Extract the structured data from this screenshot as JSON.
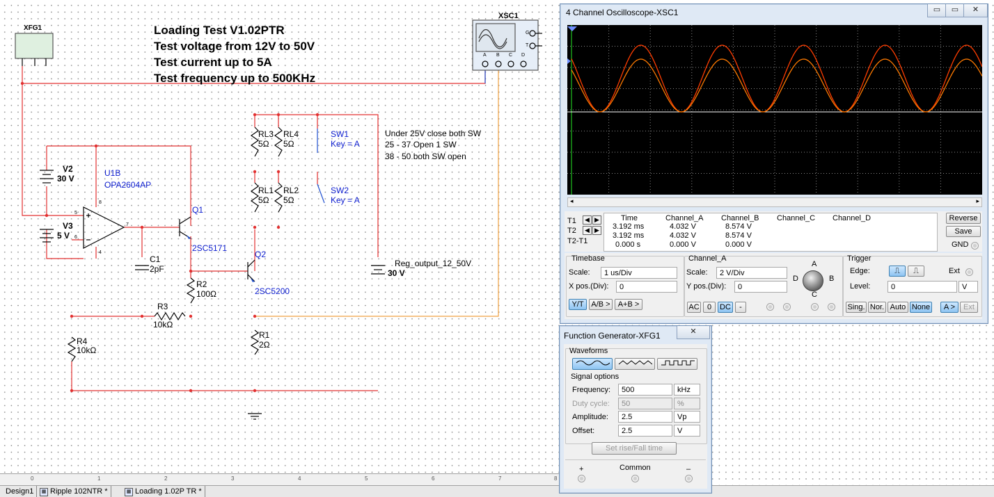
{
  "schematic": {
    "title_lines": [
      "Loading Test V1.02PTR",
      "Test voltage from 12V to 50V",
      "Test current up to 5A",
      "Test frequency up to 500KHz"
    ],
    "xfg_label": "XFG1",
    "xsc_label": "XSC1",
    "xsc_terms": [
      "A",
      "B",
      "C",
      "D",
      "G",
      "T"
    ],
    "v2_name": "V2",
    "v2_val": "30 V",
    "v3_name": "V3",
    "v3_val": "5 V",
    "u1_name": "U1B",
    "u1_part": "OPA2604AP",
    "pin_labels": [
      "8",
      "5",
      "6",
      "4",
      "7"
    ],
    "q1_name": "Q1",
    "q1_part": "2SC5171",
    "q2_name": "Q2",
    "q2_part": "2SC5200",
    "c1_name": "C1",
    "c1_val": "2pF",
    "r1_name": "R1",
    "r1_val": "2Ω",
    "r2_name": "R2",
    "r2_val": "100Ω",
    "r3_name": "R3",
    "r3_val": "10kΩ",
    "r4_name": "R4",
    "r4_val": "10kΩ",
    "rl3_name": "RL3",
    "rl3_val": "5Ω",
    "rl4_name": "RL4",
    "rl4_val": "5Ω",
    "rl1_name": "RL1",
    "rl1_val": "5Ω",
    "rl2_name": "RL2",
    "rl2_val": "5Ω",
    "sw1_name": "SW1",
    "sw1_key": "Key = A",
    "sw2_name": "SW2",
    "sw2_key": "Key = A",
    "note_lines": [
      "Under 25V close both SW",
      "25 - 37 Open 1 SW",
      "38 - 50 both SW open"
    ],
    "reg_name": "Reg_output_12_50V",
    "reg_val": "30 V"
  },
  "ruler_marks": [
    "0",
    "1",
    "2",
    "3",
    "4",
    "5",
    "6",
    "7",
    "8"
  ],
  "tabs": [
    {
      "label": "Design1"
    },
    {
      "label": "Ripple 102NTR *"
    },
    {
      "label": "Loading 1.02P TR *"
    }
  ],
  "oscilloscope": {
    "title": "4 Channel Oscilloscope-XSC1",
    "close_icon": "close-icon",
    "cursor_labels": [
      "T1",
      "T2",
      "T2-T1"
    ],
    "readout_headers": [
      "Time",
      "Channel_A",
      "Channel_B",
      "Channel_C",
      "Channel_D"
    ],
    "readout_rows": [
      [
        "3.192 ms",
        "4.032 V",
        "8.574 V",
        "",
        ""
      ],
      [
        "3.192 ms",
        "4.032 V",
        "8.574 V",
        "",
        ""
      ],
      [
        "0.000 s",
        "0.000 V",
        "0.000 V",
        "",
        ""
      ]
    ],
    "reverse_label": "Reverse",
    "save_label": "Save",
    "gnd_label": "GND",
    "timebase": {
      "title": "Timebase",
      "scale_label": "Scale:",
      "scale_value": "1 us/Div",
      "xpos_label": "X pos.(Div):",
      "xpos_value": "0",
      "yt": "Y/T",
      "ab": "A/B >",
      "aplusb": "A+B >"
    },
    "channel": {
      "title": "Channel_A",
      "scale_label": "Scale:",
      "scale_value": "2  V/Div",
      "ypos_label": "Y pos.(Div):",
      "ypos_value": "0",
      "ac": "AC",
      "zero": "0",
      "dc": "DC",
      "minus": "-",
      "knob_labels": [
        "A",
        "B",
        "C",
        "D"
      ]
    },
    "trigger": {
      "title": "Trigger",
      "edge_label": "Edge:",
      "ext_label": "Ext",
      "level_label": "Level:",
      "level_value": "0",
      "level_unit": "V",
      "sing": "Sing.",
      "nor": "Nor.",
      "auto": "Auto",
      "none": "None",
      "ag": "A >",
      "ext_btn": "Ext"
    },
    "trace_colors": {
      "channel_a": "#ff3d00",
      "channel_b": "#ff7a00",
      "grid": "#8a8a8a",
      "screen": "#000000"
    }
  },
  "function_generator": {
    "title": "Function Generator-XFG1",
    "waveforms_label": "Waveforms",
    "wave_icons": [
      "sine-wave-icon",
      "triangle-wave-icon",
      "square-wave-icon"
    ],
    "signal_options_label": "Signal options",
    "frequency": {
      "label": "Frequency:",
      "value": "500",
      "unit": "kHz"
    },
    "duty": {
      "label": "Duty cycle:",
      "value": "50",
      "unit": "%"
    },
    "amplitude": {
      "label": "Amplitude:",
      "value": "2.5",
      "unit": "Vp"
    },
    "offset": {
      "label": "Offset:",
      "value": "2.5",
      "unit": "V"
    },
    "set_rise_fall": "Set rise/Fall time",
    "plus": "+",
    "common": "Common",
    "minus": "–"
  }
}
